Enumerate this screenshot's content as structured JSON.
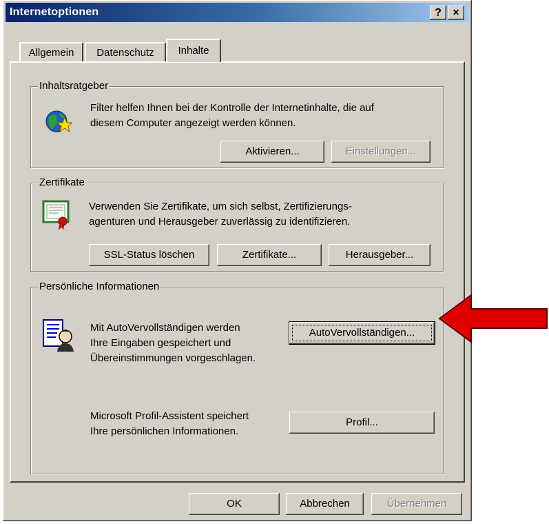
{
  "window": {
    "title": "Internetoptionen",
    "help_glyph": "?",
    "close_glyph": "×"
  },
  "tabs": [
    {
      "label": "Allgemein",
      "active": false
    },
    {
      "label": "Datenschutz",
      "active": false
    },
    {
      "label": "Inhalte",
      "active": true
    }
  ],
  "content_advisor": {
    "title": "Inhaltsratgeber",
    "description_line1": "Filter helfen Ihnen bei der Kontrolle der Internetinhalte, die auf",
    "description_line2": "diesem Computer angezeigt werden können.",
    "enable_label": "Aktivieren...",
    "settings_label": "Einstellungen..."
  },
  "certificates": {
    "title": "Zertifikate",
    "description_line1": "Verwenden Sie Zertifikate, um sich selbst, Zertifizierungs-",
    "description_line2": "agenturen und Herausgeber zuverlässig zu identifizieren.",
    "clear_ssl_label": "SSL-Status löschen",
    "certificates_label": "Zertifikate...",
    "publishers_label": "Herausgeber..."
  },
  "personal": {
    "title": "Persönliche Informationen",
    "autocomplete_line1": "Mit AutoVervollständigen werden",
    "autocomplete_line2": "Ihre Eingaben gespeichert und",
    "autocomplete_line3": "Übereinstimmungen vorgeschlagen.",
    "autocomplete_label": "AutoVervollständigen...",
    "profile_line1": "Microsoft Profil-Assistent speichert",
    "profile_line2": "Ihre persönlichen Informationen.",
    "profile_label": "Profil..."
  },
  "footer": {
    "ok_label": "OK",
    "cancel_label": "Abbrechen",
    "apply_label": "Übernehmen"
  },
  "colors": {
    "arrow": "#e00000",
    "face": "#d4d0c8",
    "titlebar": "#0a246a"
  }
}
